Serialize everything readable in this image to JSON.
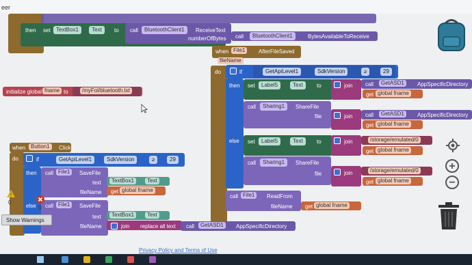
{
  "window": {
    "title_fragment": "eer"
  },
  "workspace": {
    "top_block": {
      "then": "then",
      "set": "set",
      "target_component": "TextBox1",
      "target_prop": "Text",
      "to": "to",
      "call": "call",
      "bt_component": "BluetoothClient1",
      "bt_method": "ReceiveText",
      "param": "numberOfBytes",
      "bt_component2": "BluetoothClient1",
      "bt_method2": "BytesAvailableToReceive"
    },
    "global_init": {
      "label": "initialize global",
      "name": "fname",
      "to": "to",
      "value": "/myFol/bluetooth.txt"
    },
    "after_save": {
      "when": "when",
      "component": "File1",
      "event": "AfterFileSaved",
      "param": "fileName",
      "do": "do",
      "if": "if",
      "api_component": "GetApiLevel1",
      "api_prop": "SdkVersion",
      "op": "≥",
      "api_value": "29",
      "then": "then",
      "set": "set",
      "label_component": "Label5",
      "label_prop": "Text",
      "to": "to",
      "join": "join",
      "call": "call",
      "asd_component": "GetASD1",
      "asd_method": "AppSpecificDirectory",
      "get": "get",
      "global_fname": "global fname",
      "share_call": "call",
      "share_component": "Sharing1",
      "share_method": "ShareFile",
      "file": "file",
      "else": "else",
      "storage_path": "/storage/emulated/0",
      "readfrom_component": "File1",
      "readfrom_method": "ReadFrom",
      "fileName": "fileName"
    },
    "button_click": {
      "when": "when",
      "component": "Button1",
      "event": "Click",
      "do": "do",
      "if": "if",
      "api_component": "GetApiLevel1",
      "api_prop": "SdkVersion",
      "op": "≥",
      "api_value": "29",
      "then": "then",
      "call": "call",
      "file_component": "File1",
      "save_method": "SaveFile",
      "text": "text",
      "textbox": "TextBox1",
      "textbox_prop": "Text",
      "fileName": "fileName",
      "get": "get",
      "global_fname": "global fname",
      "else": "else",
      "file_component2": "File1",
      "save_method2": "SaveFile",
      "text2": "text",
      "textbox2": "TextBox1",
      "textbox_prop2": "Text",
      "fileName2": "fileName",
      "join": "join",
      "replace_all": "replace all text",
      "call2": "call",
      "asd_component": "GetASD1",
      "asd_method": "AppSpecificDirectory"
    },
    "warnings": {
      "show_warnings": "Show Warnings",
      "count_a": "0",
      "count_b": "0"
    },
    "footer": {
      "privacy": "Privacy Policy and Terms of Use"
    },
    "zoom": {
      "plus": "+",
      "minus": "−"
    }
  }
}
